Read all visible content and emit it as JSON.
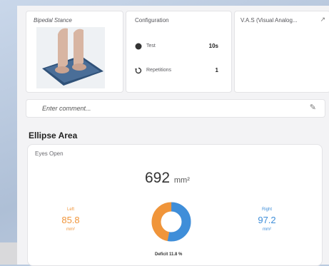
{
  "colors": {
    "orange": "#f0953a",
    "blue": "#3f8ed9"
  },
  "stance_card": {
    "title": "Bipedal Stance"
  },
  "config_card": {
    "title": "Configuration",
    "rows": [
      {
        "icon": "timer-icon",
        "label": "Test",
        "value": "10s"
      },
      {
        "icon": "repeat-icon",
        "label": "Repetitions",
        "value": "1"
      }
    ]
  },
  "vas_card": {
    "title": "V.A.S (Visual Analog..."
  },
  "comment": {
    "placeholder": "Enter comment..."
  },
  "section": {
    "title": "Ellipse Area"
  },
  "ellipse": {
    "mode": "Eyes Open",
    "area_value": "692",
    "area_unit": "mm²",
    "left": {
      "label": "Left",
      "value": "85.8",
      "unit": "mm²"
    },
    "right": {
      "label": "Right",
      "value": "97.2",
      "unit": "mm²"
    },
    "deficit_text": "Deficit 11.8 %",
    "donut": {
      "left_fraction": 0.469,
      "right_fraction": 0.531
    }
  }
}
